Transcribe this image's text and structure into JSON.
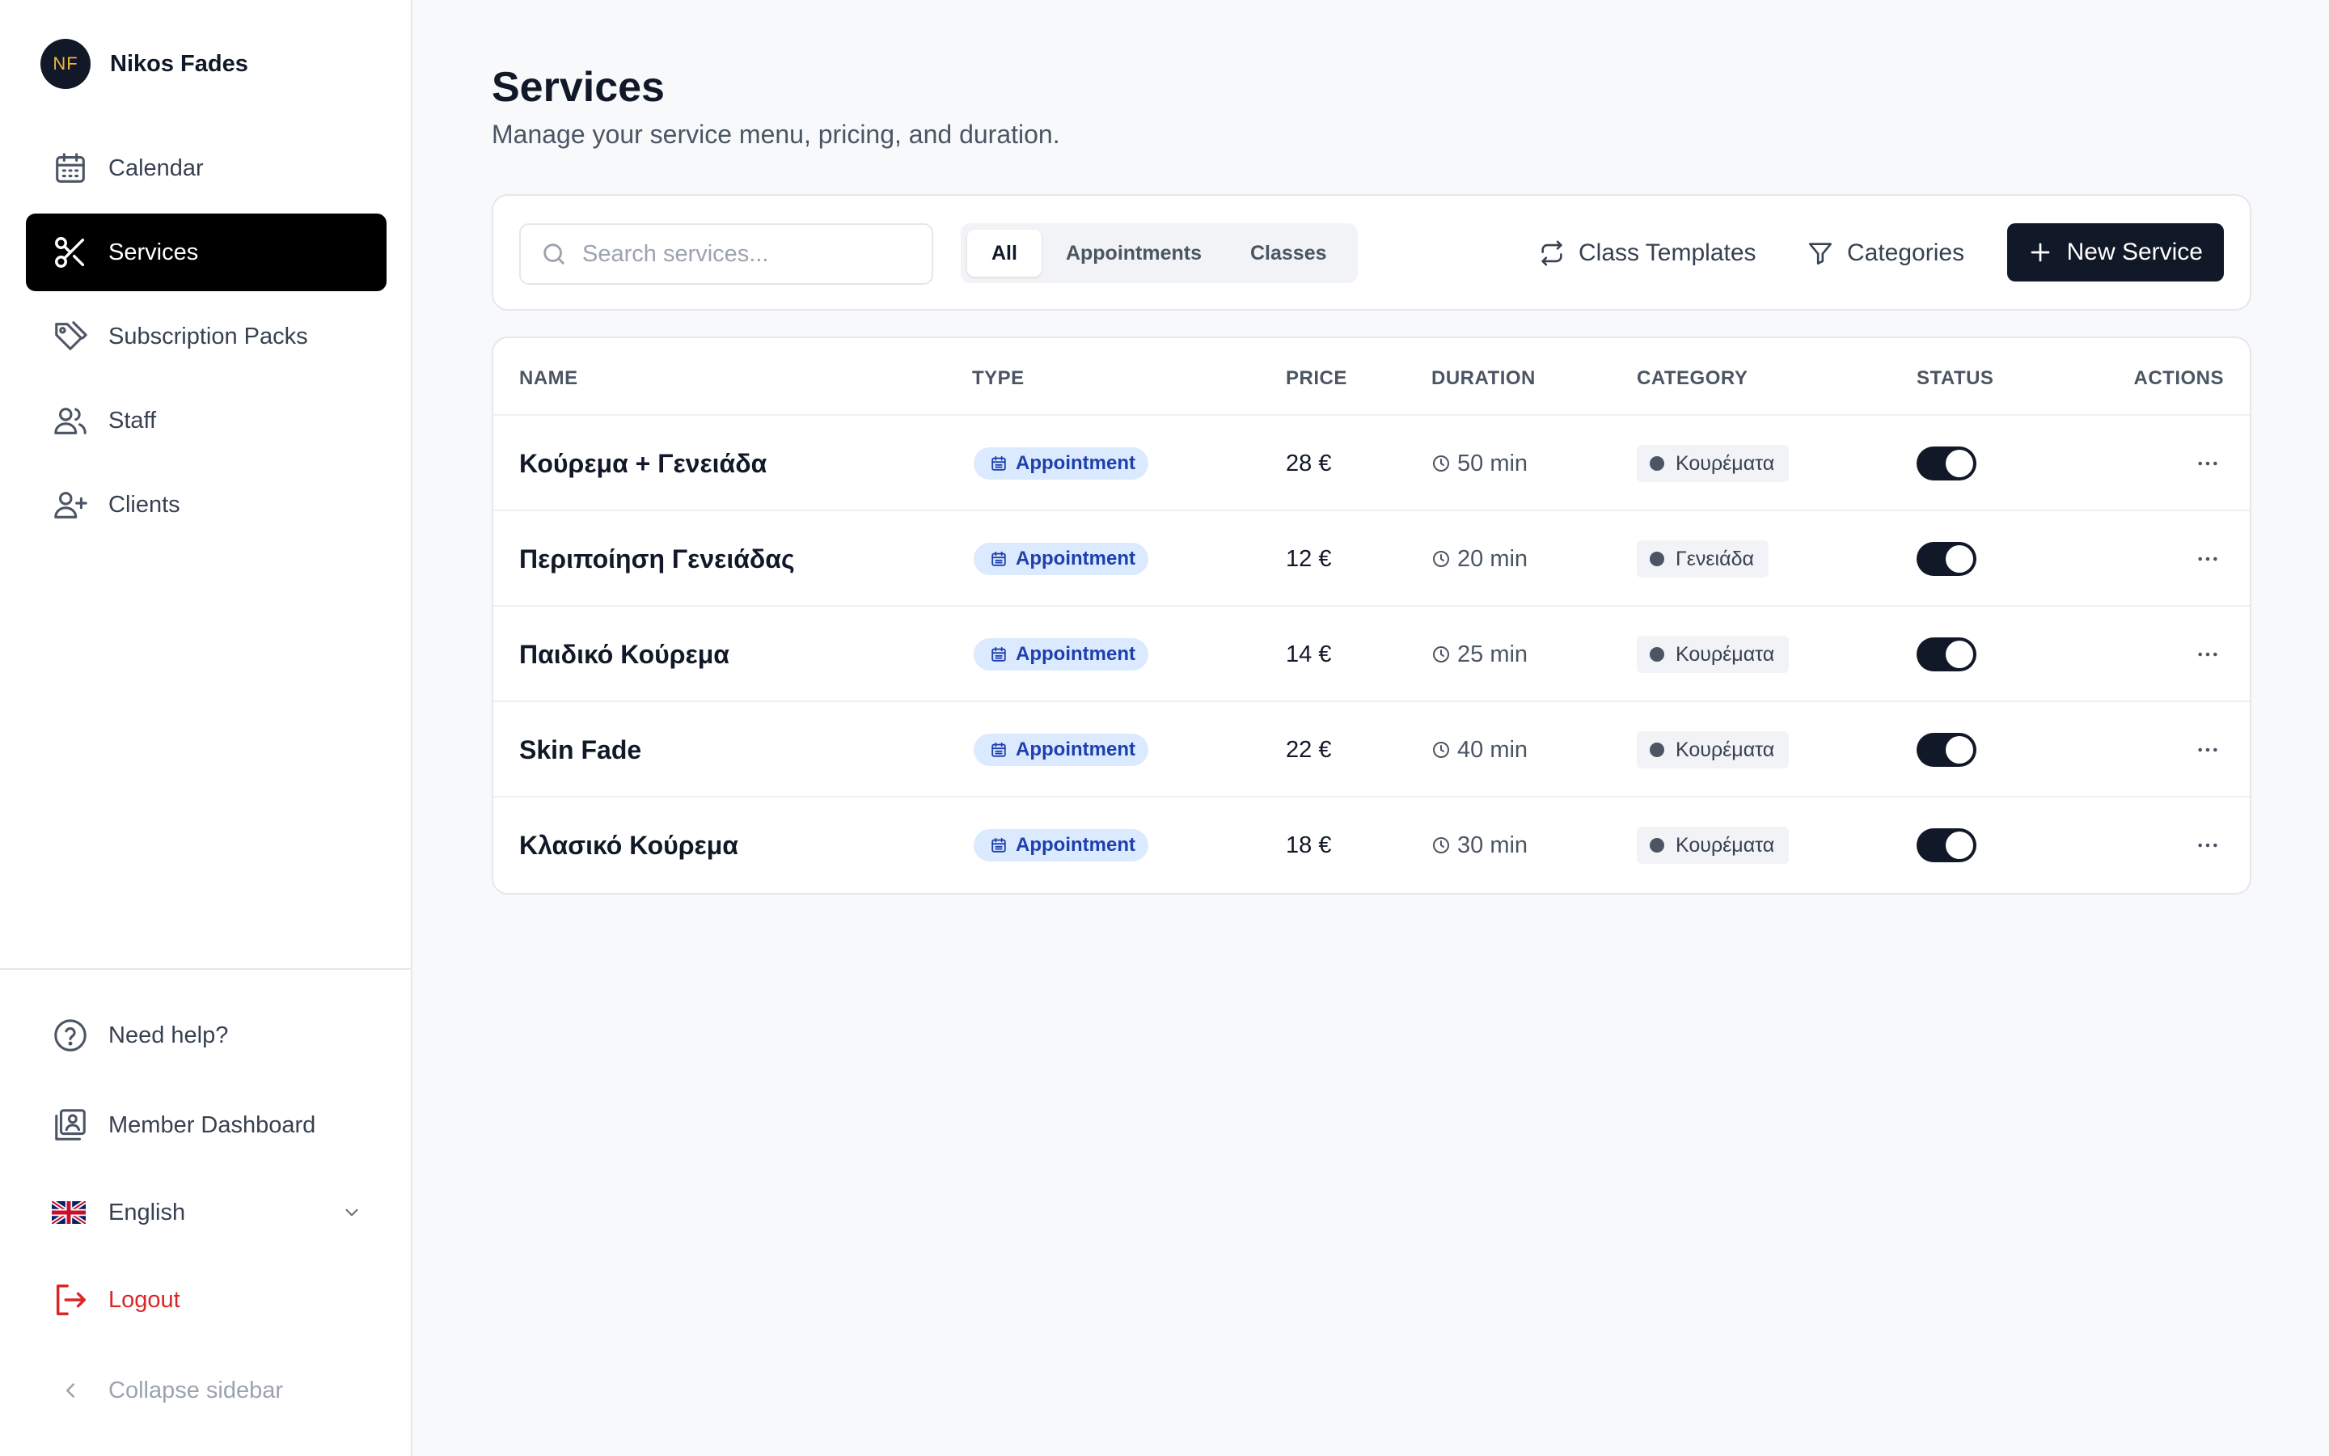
{
  "user": {
    "initials": "NF",
    "name": "Nikos Fades"
  },
  "nav": [
    {
      "label": "Calendar",
      "icon": "calendar-icon",
      "active": false
    },
    {
      "label": "Services",
      "icon": "scissors-icon",
      "active": true
    },
    {
      "label": "Subscription Packs",
      "icon": "tag-icon",
      "active": false
    },
    {
      "label": "Staff",
      "icon": "users-icon",
      "active": false
    },
    {
      "label": "Clients",
      "icon": "user-plus-icon",
      "active": false
    }
  ],
  "bottom": {
    "help": "Need help?",
    "member_dashboard": "Member Dashboard",
    "language": "English",
    "logout": "Logout",
    "collapse": "Collapse sidebar"
  },
  "page": {
    "title": "Services",
    "subtitle": "Manage your service menu, pricing, and duration."
  },
  "toolbar": {
    "search_placeholder": "Search services...",
    "filters": [
      "All",
      "Appointments",
      "Classes"
    ],
    "active_filter": "All",
    "class_templates": "Class Templates",
    "categories": "Categories",
    "new_service": "New Service"
  },
  "table": {
    "headers": [
      "NAME",
      "TYPE",
      "PRICE",
      "DURATION",
      "CATEGORY",
      "STATUS",
      "ACTIONS"
    ],
    "rows": [
      {
        "name": "Κούρεμα + Γενειάδα",
        "type": "Appointment",
        "price": "28 €",
        "duration": "50 min",
        "category": "Κουρέματα",
        "enabled": true
      },
      {
        "name": "Περιποίηση Γενειάδας",
        "type": "Appointment",
        "price": "12 €",
        "duration": "20 min",
        "category": "Γενειάδα",
        "enabled": true
      },
      {
        "name": "Παιδικό Κούρεμα",
        "type": "Appointment",
        "price": "14 €",
        "duration": "25 min",
        "category": "Κουρέματα",
        "enabled": true
      },
      {
        "name": "Skin Fade",
        "type": "Appointment",
        "price": "22 €",
        "duration": "40 min",
        "category": "Κουρέματα",
        "enabled": true
      },
      {
        "name": "Κλασικό Κούρεμα",
        "type": "Appointment",
        "price": "18 €",
        "duration": "30 min",
        "category": "Κουρέματα",
        "enabled": true
      }
    ]
  },
  "colors": {
    "primary": "#111827",
    "active_nav": "#000000",
    "badge_bg": "#dbeafe",
    "badge_text": "#1e40af",
    "logout": "#dc2626",
    "avatar_text": "#f0b43b"
  }
}
